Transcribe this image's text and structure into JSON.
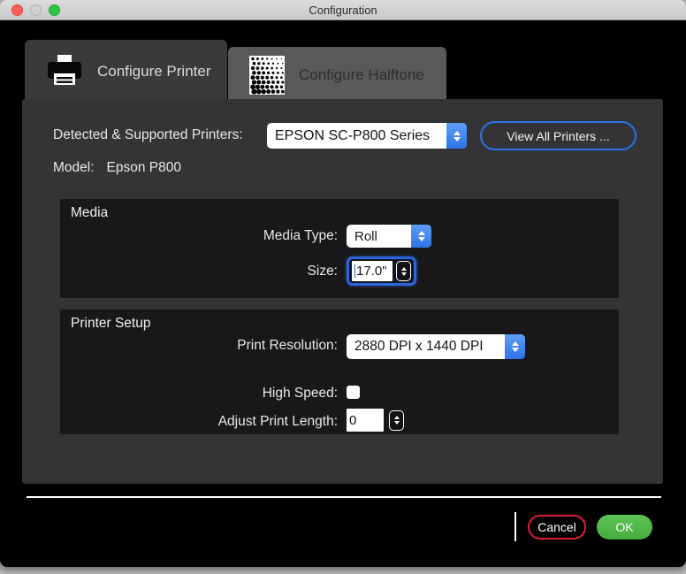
{
  "titlebar": {
    "title": "Configuration"
  },
  "tabs": {
    "printer": {
      "label": "Configure Printer",
      "active": true
    },
    "halftone": {
      "label": "Configure Halftone",
      "active": false
    }
  },
  "printers_row": {
    "label": "Detected & Supported Printers:",
    "selected": "EPSON SC-P800 Series",
    "view_all": "View All Printers ..."
  },
  "model_row": {
    "label": "Model:",
    "value": "Epson P800"
  },
  "media": {
    "title": "Media",
    "media_type": {
      "label": "Media Type:",
      "value": "Roll"
    },
    "size": {
      "label": "Size:",
      "value": "17.0\""
    }
  },
  "printer_setup": {
    "title": "Printer Setup",
    "resolution": {
      "label": "Print Resolution:",
      "value": "2880 DPI x 1440 DPI"
    },
    "high_speed": {
      "label": "High Speed:",
      "checked": false
    },
    "adjust_length": {
      "label": "Adjust Print Length:",
      "value": "0"
    }
  },
  "footer": {
    "cancel": "Cancel",
    "ok": "OK"
  },
  "colors": {
    "accent_blue": "#2f73e8",
    "focus_ring": "#2c66d9",
    "cancel_red": "#e01b3c",
    "ok_green": "#4fb848",
    "panel_gray": "#343436",
    "box_black": "#18181a"
  }
}
